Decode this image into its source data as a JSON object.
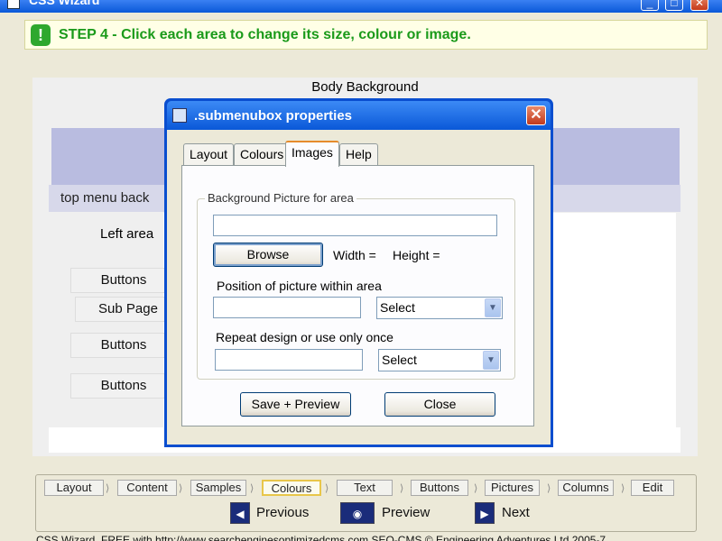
{
  "window": {
    "title": "CSS Wizard",
    "minimize": "_",
    "maximize": "□",
    "close": "✕"
  },
  "step": {
    "icon": "exclamation-icon",
    "icon_glyph": "!",
    "text": "STEP 4 - Click each area to change its size, colour or image.",
    "color": "#1a9a1a"
  },
  "preview": {
    "body_label": "Body Background",
    "top_menu_label": "top menu back",
    "left_area_label": "Left area",
    "side_buttons": [
      "Buttons",
      "Sub Page",
      "Buttons",
      "Buttons"
    ]
  },
  "dialog": {
    "title": ".submenubox properties",
    "close_glyph": "✕",
    "tabs": [
      "Layout",
      "Colours",
      "Images",
      "Help"
    ],
    "active_tab": "Images",
    "group_title": "Background Picture for area",
    "picture_value": "",
    "browse_label": "Browse",
    "width_label": "Width =",
    "height_label": "Height =",
    "position_label": "Position of picture within area",
    "position_value": "",
    "position_select": "Select",
    "repeat_label": "Repeat design or use only once",
    "repeat_value": "",
    "repeat_select": "Select",
    "save_label": "Save + Preview",
    "close_label": "Close",
    "accent_color": "#0a58d8"
  },
  "nav": {
    "steps": [
      "Layout",
      "Content",
      "Samples",
      "Colours",
      "Text",
      "Buttons",
      "Pictures",
      "Columns",
      "Edit"
    ],
    "current_step": "Colours",
    "previous_label": "Previous",
    "preview_label": "Preview",
    "next_label": "Next"
  },
  "footer": {
    "text": "CSS Wizard, FREE with http://www.searchenginesoptimizedcms.com SEO-CMS © Engineering Adventures Ltd 2005-7"
  }
}
